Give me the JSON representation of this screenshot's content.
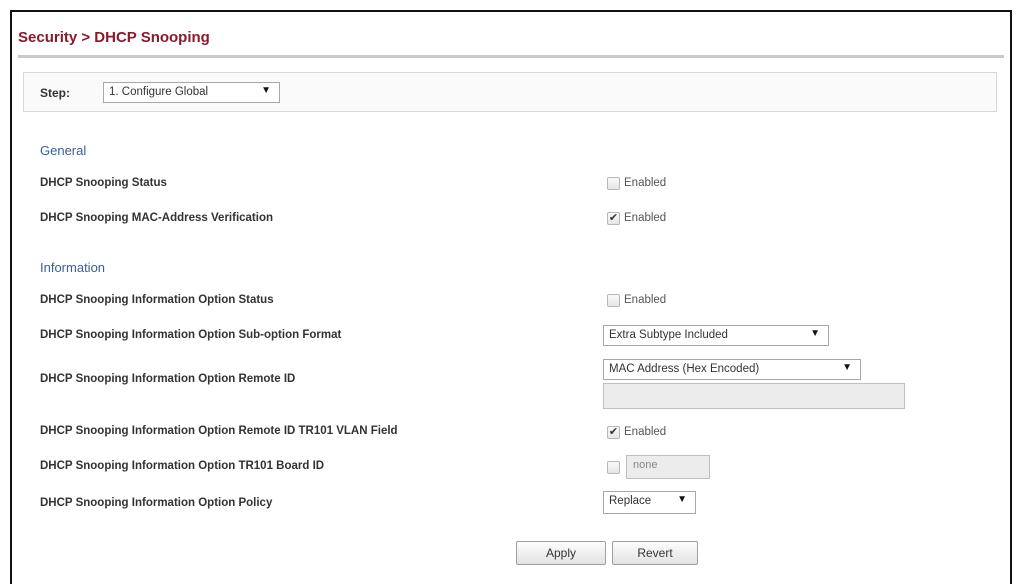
{
  "header": {
    "breadcrumb": "Security > DHCP Snooping"
  },
  "step": {
    "label": "Step:",
    "selected": "1. Configure Global"
  },
  "general": {
    "heading": "General",
    "status_label": "DHCP Snooping Status",
    "status_enabled": false,
    "mac_verification_label": "DHCP Snooping MAC-Address Verification",
    "mac_verification_enabled": true,
    "checkbox_text": "Enabled"
  },
  "information": {
    "heading": "Information",
    "option_status_label": "DHCP Snooping Information Option Status",
    "option_status_enabled": false,
    "suboption_format_label": "DHCP Snooping Information Option Sub-option Format",
    "suboption_format_value": "Extra Subtype Included",
    "remote_id_label": "DHCP Snooping Information Option Remote ID",
    "remote_id_value": "MAC Address (Hex Encoded)",
    "remote_id_text": "",
    "tr101_vlan_label": "DHCP Snooping Information Option Remote ID TR101 VLAN Field",
    "tr101_vlan_enabled": true,
    "tr101_board_label": "DHCP Snooping Information Option TR101 Board ID",
    "tr101_board_enabled": false,
    "tr101_board_value": "none",
    "policy_label": "DHCP Snooping Information Option Policy",
    "policy_value": "Replace",
    "checkbox_text": "Enabled"
  },
  "actions": {
    "apply": "Apply",
    "revert": "Revert"
  },
  "icons": {
    "check": "✔",
    "caret": "▼"
  },
  "colors": {
    "title": "#8a1a2b",
    "section_heading": "#3a5f9a"
  }
}
